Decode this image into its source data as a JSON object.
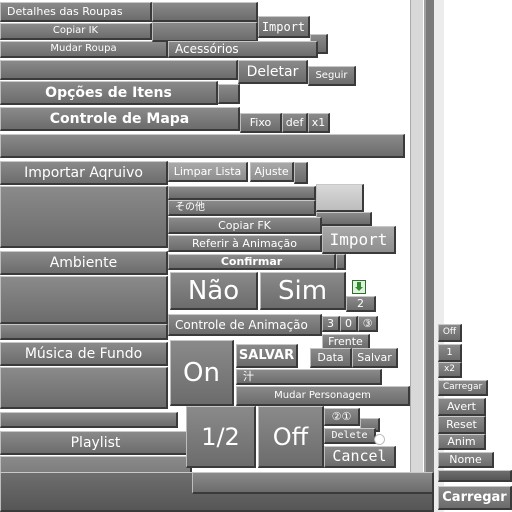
{
  "left": {
    "clothes_details": "Detalhes das Roupas",
    "copy_ik": "Copiar IK",
    "change_clothes": "Mudar Roupa",
    "item_options": "Opções de Itens",
    "map_control": "Controle de Mapa",
    "import_file": "Importar Aqruivo",
    "environment": "Ambiente",
    "background_music": "Música de Fundo",
    "playlist": "Playlist"
  },
  "middle": {
    "import_small": "Import",
    "accessories": "Acessórios",
    "delete": "Deletar",
    "follow": "Seguir",
    "fixed": "Fixo",
    "def": "def",
    "x1": "x1",
    "clear_list": "Limpar Lista",
    "adjust": "Ajuste",
    "other_jp": "その他",
    "copy_fk": "Copiar FK",
    "refer_animation": "Referir à Animação",
    "import_big": "Import",
    "confirm": "Confirmar",
    "no": "Não",
    "yes": "Sim",
    "num_2": "2",
    "animation_control": "Controle de Animação",
    "three": "3",
    "zero": "0",
    "three_circled": "③",
    "front": "Frente",
    "on": "On",
    "save": "SALVAR",
    "data": "Data",
    "save_small": "Salvar",
    "jp_char": "汁",
    "change_character": "Mudar Personagem",
    "half": "1/2",
    "off_big": "Off",
    "circled_2_1": "②①",
    "delete_small": "Delete",
    "cancel": "Cancel"
  },
  "right": {
    "off": "Off",
    "one": "1",
    "x2": "x2",
    "load_small": "Carregar",
    "avert": "Avert",
    "reset": "Reset",
    "anim": "Anim",
    "name": "Nome",
    "load": "Carregar"
  }
}
